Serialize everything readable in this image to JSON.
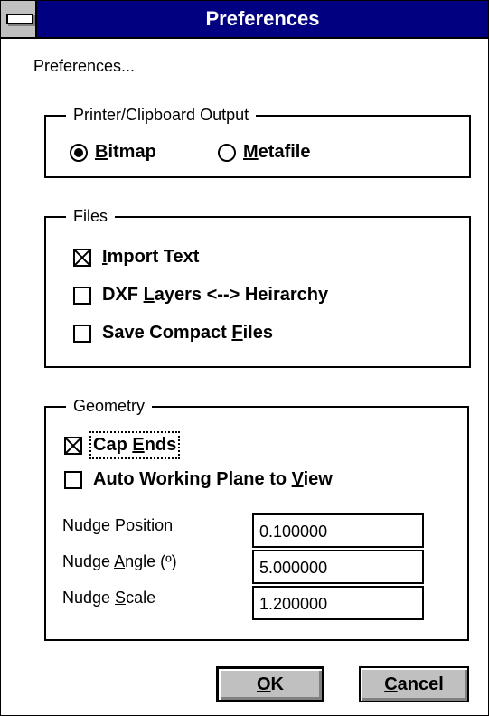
{
  "window": {
    "title": "Preferences"
  },
  "caption": "Preferences...",
  "printer_group": {
    "legend": "Printer/Clipboard Output",
    "options": [
      {
        "mnemonic": "B",
        "rest": "itmap",
        "selected": true
      },
      {
        "mnemonic": "M",
        "rest": "etafile",
        "selected": false
      }
    ]
  },
  "files_group": {
    "legend": "Files",
    "options": [
      {
        "before": "",
        "mnemonic": "I",
        "after": "mport Text",
        "checked": true
      },
      {
        "before": "DXF ",
        "mnemonic": "L",
        "after": "ayers <--> Heirarchy",
        "checked": false
      },
      {
        "before": "Save Compact ",
        "mnemonic": "F",
        "after": "iles",
        "checked": false
      }
    ]
  },
  "geometry_group": {
    "legend": "Geometry",
    "options": [
      {
        "before": "Cap ",
        "mnemonic": "E",
        "after": "nds",
        "checked": true
      },
      {
        "before": "Auto Working Plane to ",
        "mnemonic": "V",
        "after": "iew",
        "checked": false
      }
    ],
    "fields": [
      {
        "label_before": "Nudge ",
        "mnemonic": "P",
        "label_after": "osition",
        "value": "0.100000"
      },
      {
        "label_before": "Nudge ",
        "mnemonic": "A",
        "label_after": "ngle (º)",
        "value": "5.000000"
      },
      {
        "label_before": "Nudge ",
        "mnemonic": "S",
        "label_after": "cale",
        "value": "1.200000"
      }
    ]
  },
  "buttons": {
    "ok": {
      "mnemonic": "O",
      "rest": "K"
    },
    "cancel": {
      "mnemonic": "C",
      "rest": "ancel"
    }
  }
}
